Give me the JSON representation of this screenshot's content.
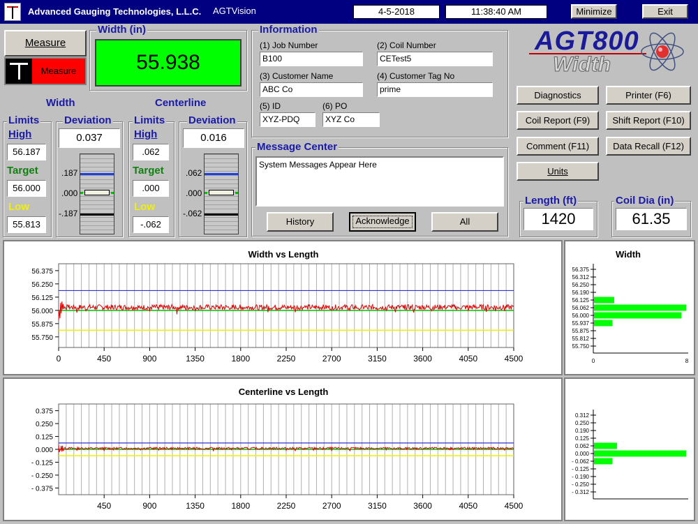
{
  "titlebar": {
    "company": "Advanced Gauging Technologies, L.L.C.",
    "app": "AGTVision",
    "date": "4-5-2018",
    "time": "11:38:40 AM",
    "minimize": "Minimize",
    "exit": "Exit"
  },
  "measure": {
    "button": "Measure",
    "indicator": "Measure"
  },
  "width_display": {
    "title": "Width  (in)",
    "value": "55.938"
  },
  "width_section": {
    "heading": "Width",
    "limits_title": "Limits",
    "high_label": "High",
    "high": "56.187",
    "target_label": "Target",
    "target": "56.000",
    "low_label": "Low",
    "low": "55.813",
    "deviation_title": "Deviation",
    "deviation": "0.037",
    "gauge_ticks": [
      ".187",
      ".000",
      "-.187"
    ]
  },
  "centerline_section": {
    "heading": "Centerline",
    "limits_title": "Limits",
    "high_label": "High",
    "high": ".062",
    "target_label": "Target",
    "target": ".000",
    "low_label": "Low",
    "low": "-.062",
    "deviation_title": "Deviation",
    "deviation": "0.016",
    "gauge_ticks": [
      ".062",
      ".000",
      "-.062"
    ]
  },
  "information": {
    "title": "Information",
    "job_label": "(1) Job Number",
    "job": "B100",
    "coil_label": "(2) Coil Number",
    "coil": "CETest5",
    "customer_label": "(3) Customer Name",
    "customer": "ABC Co",
    "tag_label": "(4) Customer Tag No",
    "tag": "prime",
    "id_label": "(5) ID",
    "id": "XYZ-PDQ",
    "po_label": "(6) PO",
    "po": "XYZ Co"
  },
  "message_center": {
    "title": "Message Center",
    "text": "System Messages Appear Here",
    "history": "History",
    "acknowledge": "Acknowledge",
    "all": "All"
  },
  "logo": {
    "line1": "AGT800",
    "line2": "Width"
  },
  "buttons": {
    "diagnostics": "Diagnostics",
    "printer": "Printer (F6)",
    "coil_report": "Coil Report (F9)",
    "shift_report": "Shift Report (F10)",
    "comment": "Comment (F11)",
    "data_recall": "Data Recall (F12)",
    "units": "Units"
  },
  "length": {
    "title": "Length (ft)",
    "value": "1420"
  },
  "coil_dia": {
    "title": "Coil Dia (in)",
    "value": "61.35"
  },
  "colors": {
    "high": "#3030d0",
    "target": "#00c000",
    "low": "#f0f000",
    "data": "#e00000",
    "bar": "#00ff00"
  },
  "chart_data": [
    {
      "type": "line",
      "title": "Width vs Length",
      "x_ticks": [
        "0",
        "450",
        "900",
        "1350",
        "1800",
        "2250",
        "2700",
        "3150",
        "3600",
        "4050",
        "4500"
      ],
      "y_ticks": [
        "56.375",
        "56.250",
        "56.125",
        "56.000",
        "55.875",
        "55.750"
      ],
      "xlim": [
        0,
        4500
      ],
      "ylim": [
        55.65,
        56.44
      ],
      "high": 56.187,
      "target": 56.0,
      "low": 55.813,
      "series": [
        {
          "mean": 56.03,
          "noise": 0.05,
          "color": "#e00000"
        }
      ]
    },
    {
      "type": "line",
      "title": "Centerline vs Length",
      "x_ticks": [
        "450",
        "900",
        "1350",
        "1800",
        "2250",
        "2700",
        "3150",
        "3600",
        "4050",
        "4500"
      ],
      "y_ticks": [
        "0.375",
        "0.250",
        "0.125",
        "0.000",
        "- 0.125",
        "- 0.250",
        "- 0.375"
      ],
      "xlim": [
        0,
        4500
      ],
      "ylim": [
        -0.44,
        0.44
      ],
      "high": 0.062,
      "target": 0.0,
      "low": -0.062,
      "series": [
        {
          "mean": 0.01,
          "noise": 0.02,
          "color": "#e00000"
        }
      ]
    },
    {
      "type": "bar",
      "title": "Width",
      "orientation": "horizontal",
      "categories": [
        "56.375",
        "56.312",
        "56.250",
        "56.190",
        "56.125",
        "56.062",
        "56.000",
        "55.937",
        "55.875",
        "55.812",
        "55.750"
      ],
      "values": [
        0,
        0,
        0,
        0,
        0.22,
        1.0,
        0.95,
        0.2,
        0,
        0,
        0
      ],
      "x_ticks": [
        "0",
        "8"
      ]
    },
    {
      "type": "bar",
      "title": "",
      "orientation": "horizontal",
      "categories": [
        "0.312",
        "0.250",
        "0.190",
        "0.125",
        "0.062",
        "0.000",
        "- 0.062",
        "- 0.125",
        "- 0.190",
        "- 0.250",
        "- 0.312"
      ],
      "values": [
        0,
        0,
        0,
        0,
        0.25,
        1.0,
        0.2,
        0,
        0,
        0,
        0
      ]
    }
  ]
}
